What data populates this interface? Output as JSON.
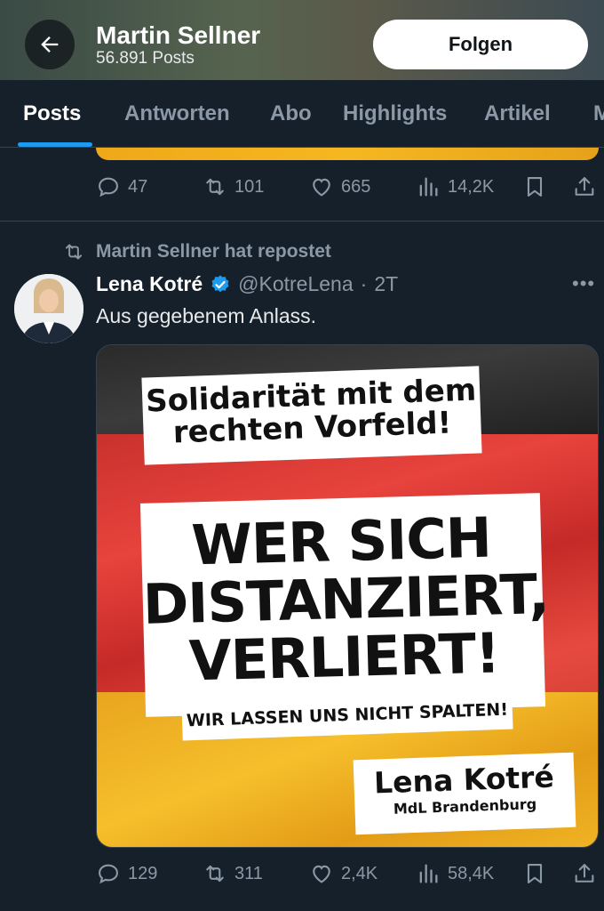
{
  "header": {
    "name": "Martin Sellner",
    "post_count": "56.891 Posts",
    "follow_label": "Folgen"
  },
  "tabs": [
    {
      "label": "Posts",
      "active": true
    },
    {
      "label": "Antworten"
    },
    {
      "label": "Abo"
    },
    {
      "label": "Highlights"
    },
    {
      "label": "Artikel"
    },
    {
      "label": "M"
    }
  ],
  "prev_tweet": {
    "replies": "47",
    "reposts": "101",
    "likes": "665",
    "views": "14,2K"
  },
  "tweet": {
    "repost_label": "Martin Sellner hat repostet",
    "author_name": "Lena Kotré",
    "handle": "@KotreLena",
    "separator": "·",
    "time": "2T",
    "text": "Aus gegebenem Anlass.",
    "image": {
      "line1": "Solidarität mit dem rechten Vorfeld!",
      "line2a": "WER SICH",
      "line2b": "DISTANZIERT,",
      "line2c": "VERLIERT!",
      "line3": "WIR LASSEN UNS NICHT SPALTEN!",
      "sig_name": "Lena Kotré",
      "sig_title": "MdL Brandenburg"
    },
    "replies": "129",
    "reposts": "311",
    "likes": "2,4K",
    "views": "58,4K"
  },
  "colors": {
    "background": "#15202b",
    "accent": "#1d9bf0",
    "muted": "#8b98a5",
    "verified": "#1d9bf0"
  }
}
